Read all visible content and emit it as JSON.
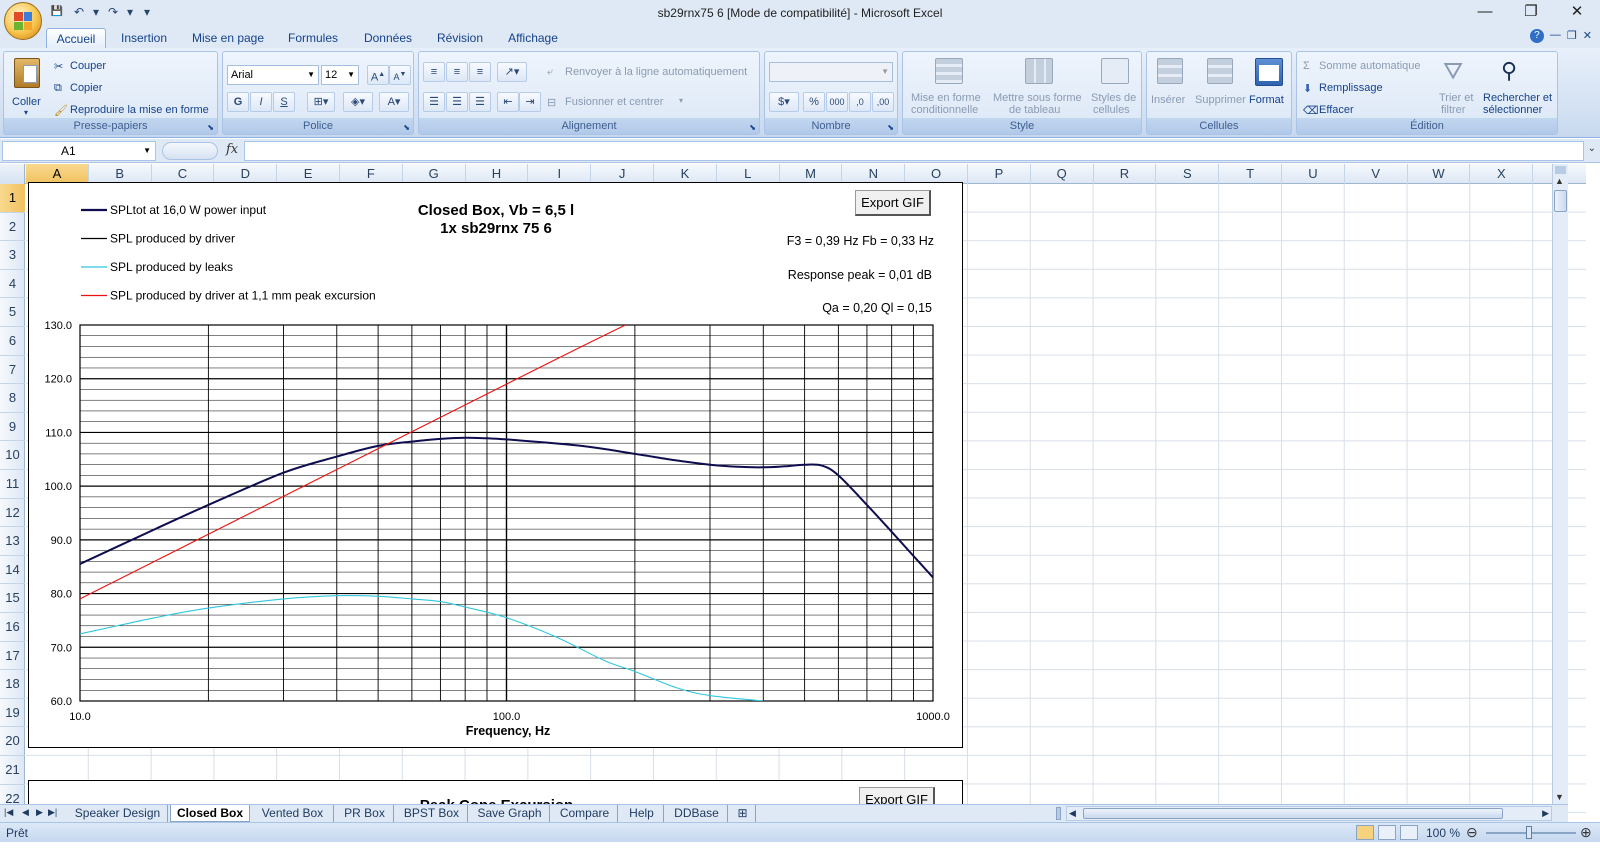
{
  "window": {
    "title": "sb29rnx75 6  [Mode de compatibilité] - Microsoft Excel",
    "min": "—",
    "max": "❐",
    "close": "✕"
  },
  "qat": {
    "save": "💾",
    "undo": "↶",
    "redo": "↷",
    "more": "▾"
  },
  "tabs": [
    "Accueil",
    "Insertion",
    "Mise en page",
    "Formules",
    "Données",
    "Révision",
    "Affichage"
  ],
  "ribbon": {
    "clipboard": {
      "paste": "Coller",
      "cut": "Couper",
      "copy": "Copier",
      "painter": "Reproduire la mise en forme",
      "label": "Presse-papiers"
    },
    "font": {
      "name": "Arial",
      "size": "12",
      "bold": "G",
      "italic": "I",
      "underline": "S",
      "label": "Police"
    },
    "alignment": {
      "wrap": "Renvoyer à la ligne automatiquement",
      "merge": "Fusionner et centrer",
      "label": "Alignement"
    },
    "number": {
      "format": "",
      "label": "Nombre"
    },
    "style": {
      "conditional_1": "Mise en forme",
      "conditional_2": "conditionnelle",
      "table_1": "Mettre sous forme",
      "table_2": "de tableau",
      "cell_1": "Styles de",
      "cell_2": "cellules",
      "label": "Style"
    },
    "cells": {
      "insert": "Insérer",
      "delete": "Supprimer",
      "format": "Format",
      "label": "Cellules"
    },
    "editing": {
      "autosum": "Somme automatique",
      "fill": "Remplissage",
      "clear": "Effacer",
      "sort_1": "Trier et",
      "sort_2": "filtrer",
      "find_1": "Rechercher et",
      "find_2": "sélectionner",
      "label": "Édition"
    }
  },
  "formula_bar": {
    "name_box": "A1",
    "fx": "fx",
    "value": ""
  },
  "columns": [
    "A",
    "B",
    "C",
    "D",
    "E",
    "F",
    "G",
    "H",
    "I",
    "J",
    "K",
    "L",
    "M",
    "N",
    "O",
    "P",
    "Q",
    "R",
    "S",
    "T",
    "U",
    "V",
    "W",
    "X"
  ],
  "rows": [
    "1",
    "2",
    "3",
    "4",
    "5",
    "6",
    "7",
    "8",
    "9",
    "10",
    "11",
    "12",
    "13",
    "14",
    "15",
    "16",
    "17",
    "18",
    "19",
    "20",
    "21",
    "22"
  ],
  "chart": {
    "export_label": "Export GIF",
    "title_1": "Closed Box, Vb = 6,5 l",
    "title_2": "1x sb29rnx 75 6",
    "info_1": "F3 = 0,39 Hz  Fb = 0,33 Hz",
    "info_2": "Response peak = 0,01 dB",
    "info_3": "Qa = 0,20  Ql = 0,15",
    "legend": [
      {
        "label": "SPLtot at 16,0 W power input",
        "color": "#0d0d4f"
      },
      {
        "label": "SPL produced by driver",
        "color": "#000000"
      },
      {
        "label": "SPL produced by leaks",
        "color": "#2fc7dd"
      },
      {
        "label": "SPL produced by driver at 1,1 mm peak excursion",
        "color": "#ee1111"
      }
    ],
    "xlabel": "Frequency,  Hz",
    "second_title": "Peak Cone Excursion",
    "second_export": "Export GIF"
  },
  "chart_data": {
    "type": "line",
    "title": "Closed Box, Vb = 6,5 l",
    "subtitle": "1x sb29rnx 75 6",
    "xlabel": "Frequency,  Hz",
    "ylabel": "",
    "xscale": "log",
    "xlim": [
      10,
      1000
    ],
    "ylim": [
      60,
      130
    ],
    "xticks": [
      "10.0",
      "100.0",
      "1000.0"
    ],
    "yticks": [
      "60.0",
      "70.0",
      "80.0",
      "90.0",
      "100.0",
      "110.0",
      "120.0",
      "130.0"
    ],
    "grid": true,
    "legend_position": "top-left",
    "series": [
      {
        "name": "SPLtot at 16,0 W power input",
        "color": "#0d0d4f",
        "x": [
          10,
          15,
          20,
          30,
          40,
          50,
          60,
          70,
          80,
          90,
          100,
          150,
          200,
          250,
          300,
          350,
          400,
          450,
          500,
          550,
          600,
          700,
          800,
          900,
          1000
        ],
        "y": [
          85.5,
          92,
          96.5,
          102.5,
          105.5,
          107.5,
          108.3,
          108.8,
          109.0,
          108.9,
          108.7,
          107.5,
          106,
          104.8,
          104,
          103.6,
          103.5,
          103.7,
          104,
          103.8,
          102,
          96.5,
          91.5,
          87,
          83
        ]
      },
      {
        "name": "SPL produced by leaks",
        "color": "#2fc7dd",
        "x": [
          10,
          15,
          20,
          30,
          40,
          50,
          60,
          70,
          80,
          100,
          130,
          170,
          200,
          250,
          300,
          400
        ],
        "y": [
          72.5,
          75.5,
          77.3,
          79,
          79.6,
          79.5,
          79.0,
          78.5,
          77.5,
          75.5,
          72,
          67.5,
          65.5,
          62.5,
          61,
          60
        ]
      },
      {
        "name": "SPL produced by driver at 1,1 mm peak excursion",
        "color": "#ee1111",
        "x": [
          10,
          100,
          190
        ],
        "y": [
          79,
          119,
          130
        ]
      }
    ]
  },
  "sheet_tabs": [
    "Speaker Design",
    "Closed Box",
    "Vented Box",
    "PR Box",
    "BPST Box",
    "Save Graph",
    "Compare",
    "Help",
    "DDBase"
  ],
  "active_sheet": "Closed Box",
  "status": {
    "ready": "Prêt",
    "zoom": "100 %"
  }
}
